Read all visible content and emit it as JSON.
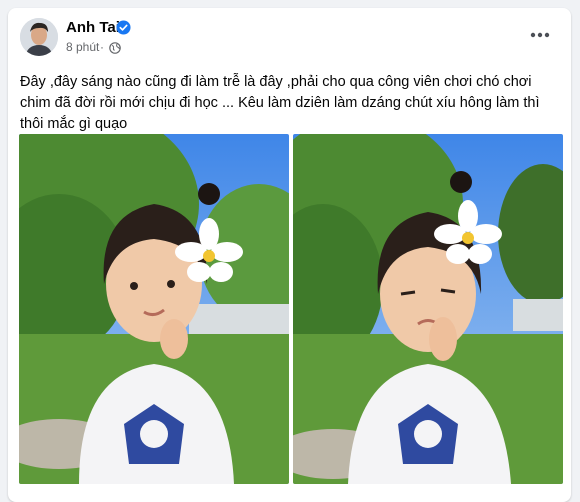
{
  "post": {
    "author": "Anh Tai",
    "time": "8 phút",
    "text": "Đây ,đây sáng nào cũng đi làm trễ là đây ,phải cho qua công viên chơi chó chơi chim đã đời rồi mới chịu đi học ... Kêu làm dziên làm dzáng chút xíu hông làm thì thôi mắc gì quạo"
  },
  "icons": {
    "verified": "verified-badge-icon",
    "audience": "globe-icon",
    "menu": "more-horizontal-icon"
  },
  "colors": {
    "verified_blue": "#1877f2",
    "text_primary": "#050505",
    "text_secondary": "#65676b"
  }
}
